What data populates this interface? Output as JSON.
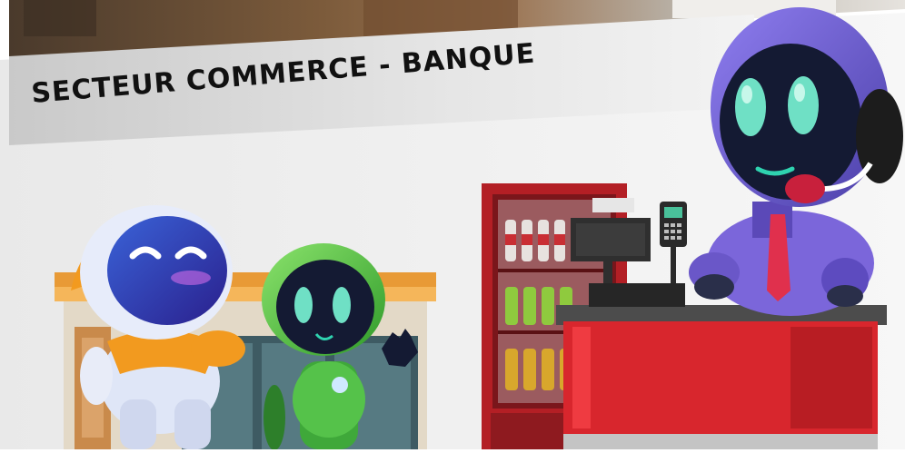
{
  "banner": {
    "heading": "SECTEUR COMMERCE - BANQUE"
  },
  "colors": {
    "band_light": "#d9d9d9",
    "background": "#f0f0f0",
    "store_awning": "#f0a640",
    "fridge_red": "#c8242a",
    "counter_red": "#d8262d",
    "robot_purple": "#7b5fd6",
    "robot_green": "#4fbf3a",
    "robot_white": "#dfe6f7",
    "robot_orange": "#f29a1f"
  },
  "illustration": {
    "left_robot_icon": "robot-orange-white-icon",
    "middle_robot_icon": "robot-green-icon",
    "cashier_robot_icon": "robot-purple-headset-icon",
    "store_icon": "storefront-icon",
    "fridge_icon": "drinks-fridge-icon",
    "register_icon": "cash-register-icon",
    "payment_terminal_icon": "card-terminal-icon"
  }
}
